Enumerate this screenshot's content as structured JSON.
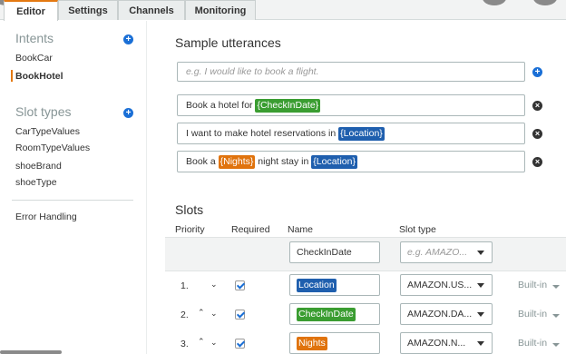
{
  "tabs": [
    "Editor",
    "Settings",
    "Channels",
    "Monitoring"
  ],
  "sidebar": {
    "intents_title": "Intents",
    "intents": [
      "BookCar",
      "BookHotel"
    ],
    "slot_types_title": "Slot types",
    "slot_types": [
      "CarTypeValues",
      "RoomTypeValues",
      "shoeBrand",
      "shoeType"
    ],
    "error_handling": "Error Handling"
  },
  "utterances": {
    "title": "Sample utterances",
    "placeholder": "e.g. I would like to book a flight.",
    "rows": [
      {
        "pre": "Book a hotel for ",
        "slot1": "{CheckInDate}",
        "mid": "",
        "slot2": "",
        "post": ""
      },
      {
        "pre": "I want to make hotel reservations in ",
        "slot1": "{Location}",
        "mid": "",
        "slot2": "",
        "post": ""
      },
      {
        "pre": "Book a ",
        "slot1": "{Nights}",
        "mid": " night stay in ",
        "slot2": "{Location}",
        "post": ""
      }
    ]
  },
  "slots": {
    "title": "Slots",
    "headers": {
      "priority": "Priority",
      "required": "Required",
      "name": "Name",
      "slot_type": "Slot type"
    },
    "new_slot": {
      "name": "CheckInDate",
      "type_placeholder": "e.g. AMAZO..."
    },
    "rows": [
      {
        "num": "1.",
        "name": "Location",
        "type": "AMAZON.US...",
        "builtin": "Built-in",
        "required": true
      },
      {
        "num": "2.",
        "name": "CheckInDate",
        "type": "AMAZON.DA...",
        "builtin": "Built-in",
        "required": true
      },
      {
        "num": "3.",
        "name": "Nights",
        "type": "AMAZON.N...",
        "builtin": "Built-in",
        "required": true
      }
    ]
  },
  "colors": {
    "accent": "#e47911",
    "link_blue": "#1a6fd6",
    "slot_blue": "#1f5fae",
    "slot_green": "#3a9d31",
    "slot_orange": "#e0730d"
  }
}
